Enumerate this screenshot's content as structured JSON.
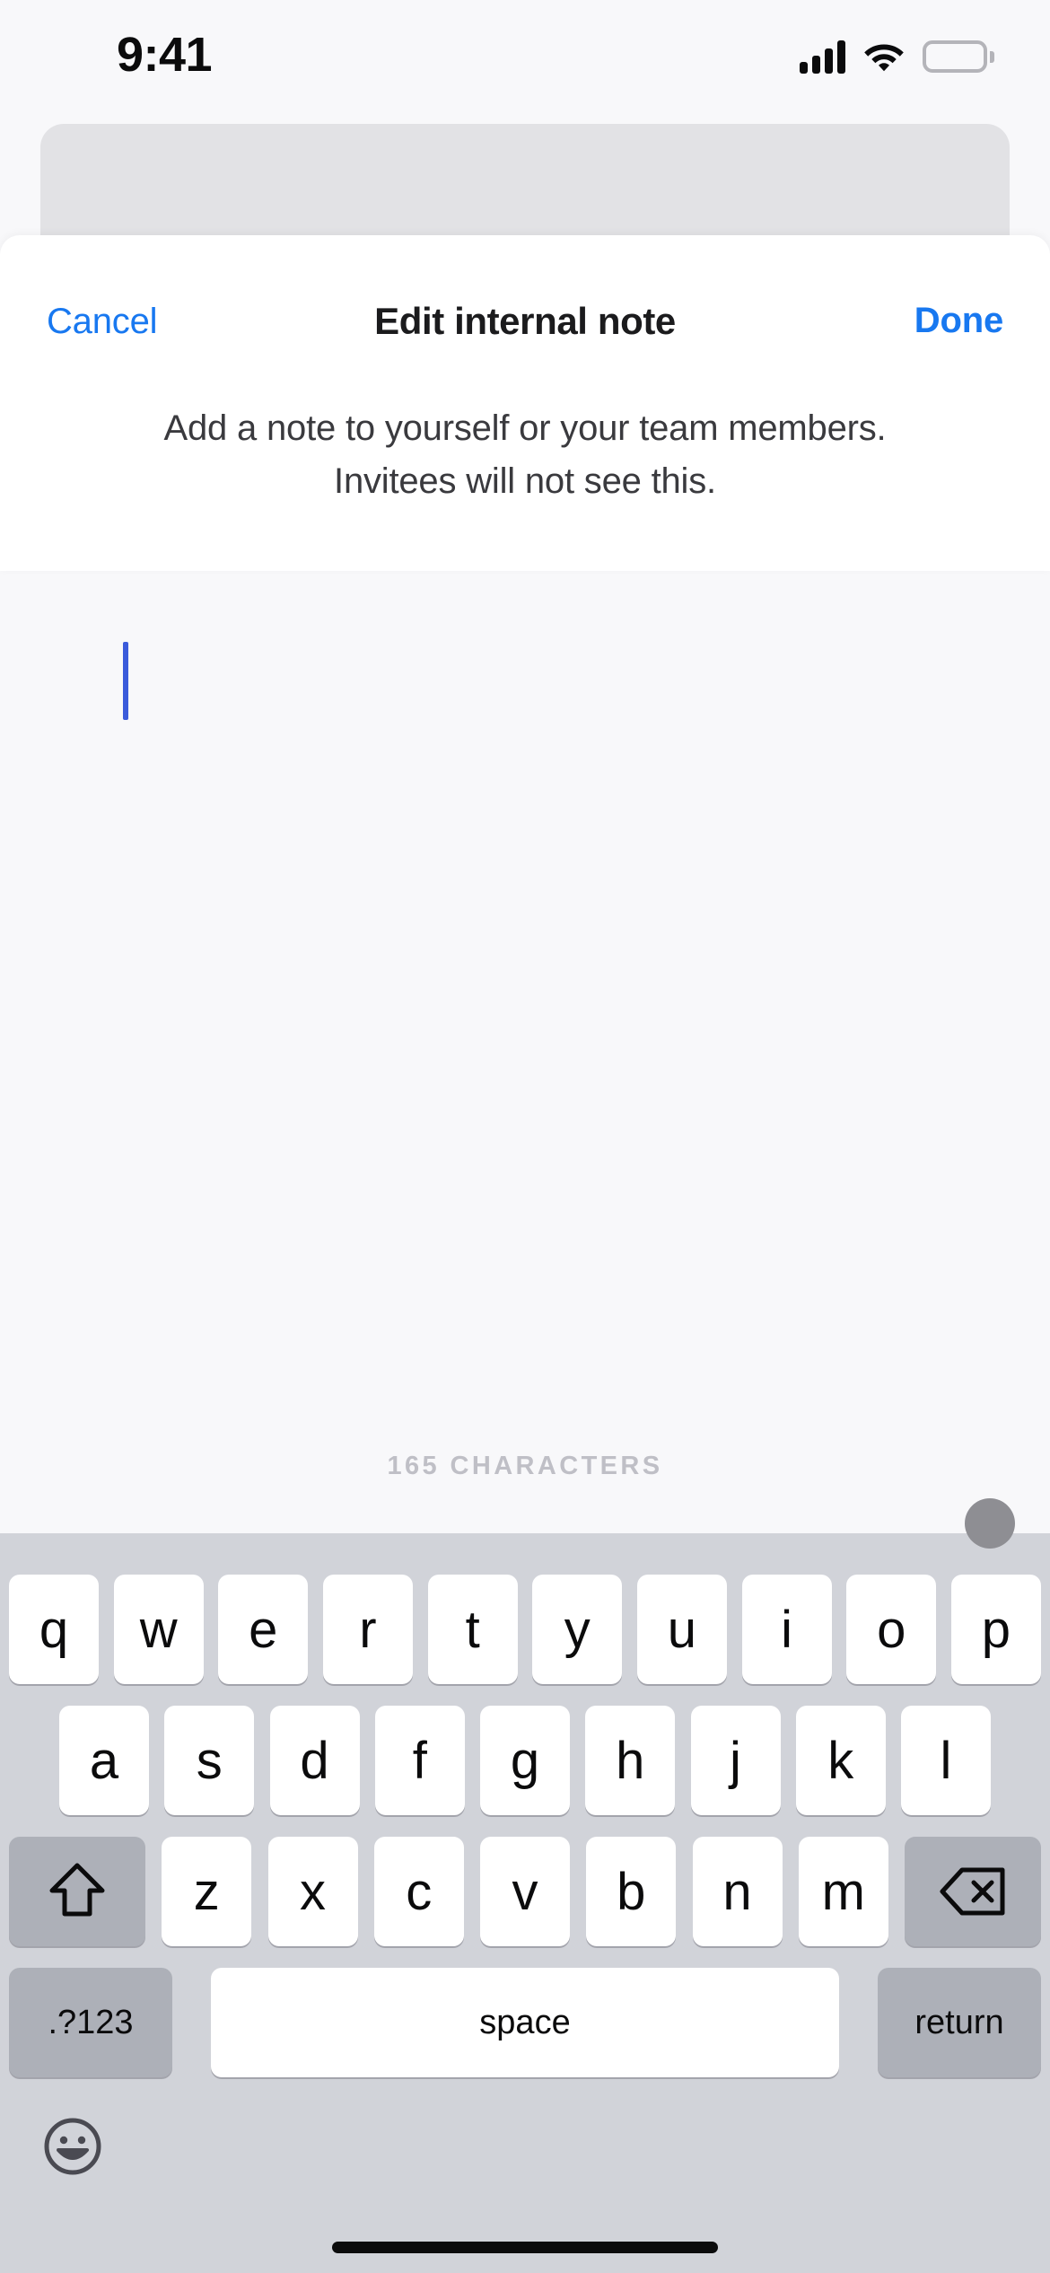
{
  "status_bar": {
    "time": "9:41",
    "signal_icon": "cellular-signal-icon",
    "wifi_icon": "wifi-icon",
    "battery_icon": "battery-full-icon"
  },
  "sheet": {
    "cancel_label": "Cancel",
    "title": "Edit internal note",
    "done_label": "Done",
    "description": "Add a note to yourself or your team members. Invitees will not see this."
  },
  "note_editor": {
    "value": "",
    "placeholder": "",
    "character_counter": "165 CHARACTERS",
    "caret_visible": true
  },
  "keyboard": {
    "row1": [
      "q",
      "w",
      "e",
      "r",
      "t",
      "y",
      "u",
      "i",
      "o",
      "p"
    ],
    "row2": [
      "a",
      "s",
      "d",
      "f",
      "g",
      "h",
      "j",
      "k",
      "l"
    ],
    "row3_letters": [
      "z",
      "x",
      "c",
      "v",
      "b",
      "n",
      "m"
    ],
    "shift_label": "",
    "backspace_label": "",
    "numeric_label": ".?123",
    "space_label": "space",
    "return_label": "return",
    "emoji_label": "",
    "handle_label": ""
  },
  "colors": {
    "accent_blue": "#1878f0",
    "caret_blue": "#3b5bdb",
    "sheet_background": "#ffffff",
    "page_background": "#f8f8fa",
    "keyboard_background": "#d1d3d9",
    "key_white": "#ffffff",
    "key_modifier": "#adb0b8",
    "counter_gray": "#bfbfc6",
    "card_gray": "#e2e2e5"
  }
}
